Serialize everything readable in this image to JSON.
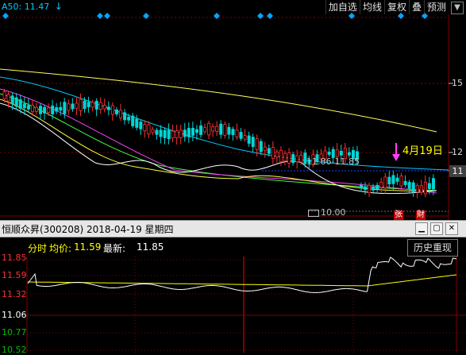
{
  "header": {
    "ma_label": "A50: 11.47",
    "arrow_icon": "down-arrow-icon"
  },
  "toolbar": {
    "items": [
      "加自选",
      "均线",
      "复权",
      "叠",
      "预测"
    ],
    "dropdown_icon": "chevron-down-icon",
    "close_icon": "close-icon"
  },
  "kline": {
    "price_axis": [
      "15",
      "12",
      "11"
    ],
    "current_price_tag": "11",
    "range_label": "11.86-11.85",
    "date_annotation": "4月19日",
    "low_label": "10.00",
    "marker_labels": [
      "张",
      "財"
    ],
    "colors": {
      "up": "#ff3030",
      "down": "#00d6d6",
      "ma5": "#ffffff",
      "ma10": "#ffff40",
      "ma20": "#ff40ff",
      "ma30": "#40ff40",
      "ma60": "#00c8ff",
      "ma120": "#ffff60",
      "annotation": "#ffff00",
      "magenta": "#ff40ff",
      "diamond": "#00a8ff"
    }
  },
  "subpanel": {
    "title": "恒顺众昇(300208) 2018-04-19 星期四",
    "min_icon": "minimize-icon",
    "restore_icon": "restore-icon",
    "close_icon": "close-icon"
  },
  "minute": {
    "label_fenshi": "分时",
    "label_avg": "均价:",
    "avg_value": "11.59",
    "label_latest": "最新:",
    "latest_value": "11.85",
    "history_button": "历史重现",
    "price_axis": [
      "11.85",
      "11.59",
      "11.32",
      "11.06",
      "10.77",
      "10.52"
    ],
    "colors": {
      "price_line": "#ffffff",
      "avg_line": "#ffff00",
      "grid": "#800000",
      "axis_red": "#ff3030",
      "axis_white": "#ffffff",
      "axis_green": "#00c000"
    }
  }
}
